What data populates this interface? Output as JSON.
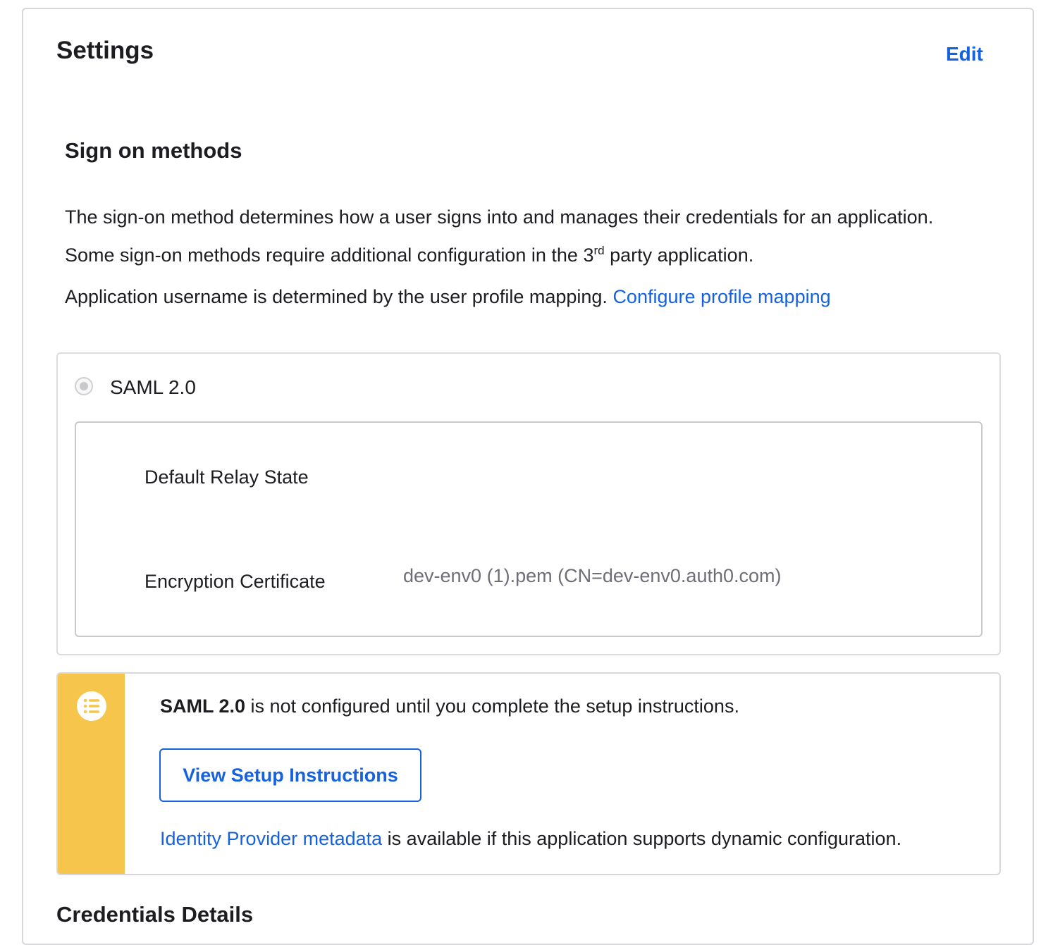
{
  "settings": {
    "title": "Settings",
    "edit_label": "Edit"
  },
  "sign_on": {
    "title": "Sign on methods",
    "description_part1": "The sign-on method determines how a user signs into and manages their credentials for an application. Some sign-on methods require additional configuration in the 3",
    "description_sup": "rd",
    "description_part2": " party application.",
    "username_text": "Application username is determined by the user profile mapping. ",
    "configure_link": "Configure profile mapping"
  },
  "saml": {
    "label": "SAML 2.0",
    "fields": {
      "relay_state_label": "Default Relay State",
      "encryption_label": "Encryption Certificate",
      "encryption_value": "dev-env0 (1).pem (CN=dev-env0.auth0.com)"
    }
  },
  "callout": {
    "icon": "list-icon",
    "bold_text": "SAML 2.0",
    "text": " is not configured until you complete the setup instructions.",
    "button_label": "View Setup Instructions",
    "metadata_link": "Identity Provider metadata",
    "metadata_text": " is available if this application supports dynamic configuration.",
    "accent_color": "#f6c54b"
  },
  "credentials": {
    "title": "Credentials Details"
  },
  "colors": {
    "link": "#1662dd",
    "text": "#1d1d21",
    "muted": "#6e6e78"
  }
}
